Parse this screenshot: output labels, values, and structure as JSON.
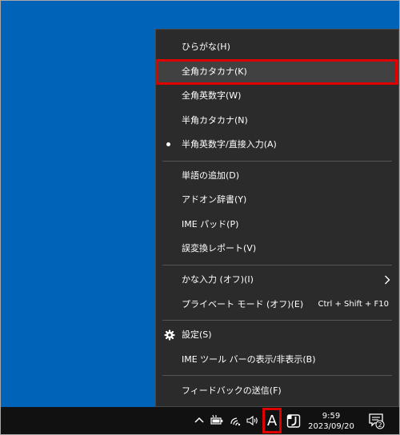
{
  "menu": {
    "items": [
      {
        "label": "ひらがな(H)"
      },
      {
        "label": "全角カタカナ(K)"
      },
      {
        "label": "全角英数字(W)"
      },
      {
        "label": "半角カタカナ(N)"
      },
      {
        "label": "半角英数字/直接入力(A)"
      },
      {
        "label": "単語の追加(D)"
      },
      {
        "label": "アドオン辞書(Y)"
      },
      {
        "label": "IME パッド(P)"
      },
      {
        "label": "誤変換レポート(V)"
      },
      {
        "label": "かな入力 (オフ)(I)"
      },
      {
        "label": "プライベート モード (オフ)(E)",
        "shortcut": "Ctrl + Shift + F10"
      },
      {
        "label": "設定(S)"
      },
      {
        "label": "IME ツール バーの表示/非表示(B)"
      },
      {
        "label": "フィードバックの送信(F)"
      }
    ],
    "highlighted_item": "全角カタカナ(K)",
    "selected_item": "半角英数字/直接入力(A)"
  },
  "taskbar": {
    "ime_mode_letter": "A",
    "clock_time": "9:59",
    "clock_date": "2023/09/20",
    "notification_count": "2",
    "icons": [
      "chevron-up-icon",
      "battery-icon",
      "wifi-icon",
      "speaker-icon",
      "ime-mode-icon",
      "input-app-icon",
      "notification-icon"
    ]
  },
  "colors": {
    "desktop": "#0063b8",
    "menu_background": "#2b2b2b",
    "menu_hover": "#414141",
    "annotation_red": "#e10000",
    "taskbar": "#111111"
  }
}
